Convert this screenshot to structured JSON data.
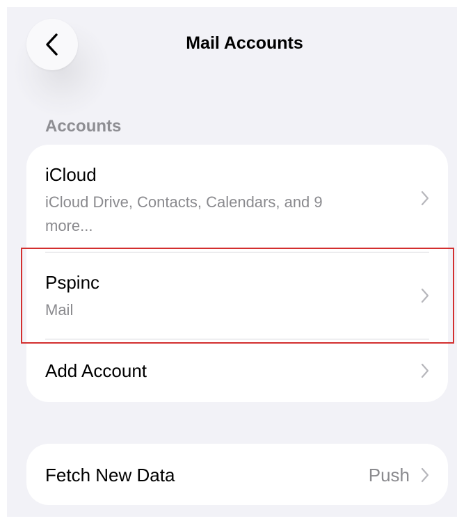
{
  "nav": {
    "title": "Mail Accounts",
    "back_icon": "chevron-left-icon"
  },
  "accounts_section": {
    "header": "Accounts",
    "rows": [
      {
        "title": "iCloud",
        "subtitle": "iCloud Drive, Contacts, Calendars, and 9 more...",
        "icon": "chevron-right-icon"
      },
      {
        "title": "Pspinc",
        "subtitle": "Mail",
        "icon": "chevron-right-icon",
        "highlighted": true
      },
      {
        "title": "Add Account",
        "icon": "chevron-right-icon"
      }
    ]
  },
  "fetch_section": {
    "title": "Fetch New Data",
    "value": "Push",
    "icon": "chevron-right-icon"
  },
  "colors": {
    "background": "#f2f2f7",
    "card": "#ffffff",
    "secondary_text": "#8a8a8e",
    "highlight_border": "#d32f2f"
  }
}
